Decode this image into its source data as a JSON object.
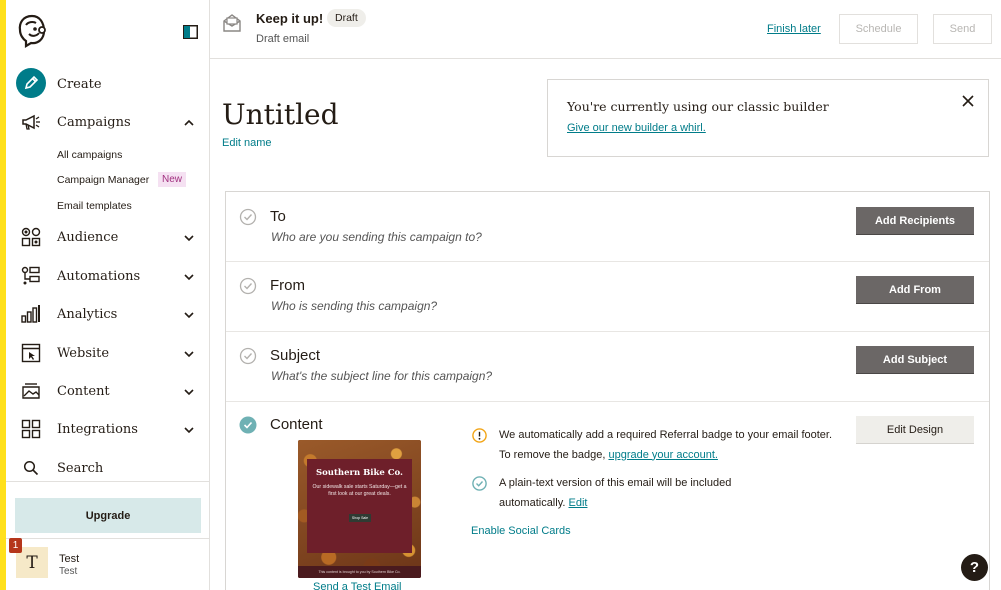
{
  "sidebar": {
    "create_label": "Create",
    "campaigns_label": "Campaigns",
    "campaigns_sub": {
      "all": "All campaigns",
      "manager": "Campaign Manager",
      "new_badge": "New",
      "templates": "Email templates"
    },
    "audience_label": "Audience",
    "automations_label": "Automations",
    "analytics_label": "Analytics",
    "website_label": "Website",
    "content_label": "Content",
    "integrations_label": "Integrations",
    "search_label": "Search",
    "upgrade_label": "Upgrade",
    "account": {
      "initial": "T",
      "name": "Test",
      "sub": "Test",
      "notification_count": "1"
    }
  },
  "topbar": {
    "title": "Keep it up!",
    "badge": "Draft",
    "subtitle": "Draft email",
    "finish_later": "Finish later",
    "schedule": "Schedule",
    "send": "Send"
  },
  "main": {
    "campaign_title": "Untitled",
    "edit_name": "Edit name",
    "classic": {
      "text": "You're currently using our classic builder",
      "link": "Give our new builder a whirl."
    },
    "checklist": [
      {
        "title": "To",
        "desc": "Who are you sending this campaign to?",
        "action": "Add Recipients"
      },
      {
        "title": "From",
        "desc": "Who is sending this campaign?",
        "action": "Add From"
      },
      {
        "title": "Subject",
        "desc": "What's the subject line for this campaign?",
        "action": "Add Subject"
      },
      {
        "title": "Content",
        "action": "Edit Design"
      }
    ],
    "content": {
      "thumbnail": {
        "title": "Southern Bike Co.",
        "text": "Our sidewalk sale starts Saturday—get a first look at our great deals.",
        "button": "Shop Sale",
        "footer": "This content is brought to you by Southern Bike Co."
      },
      "send_test": "Send a Test Email",
      "notice1_text": "We automatically add a required Referral badge to your email footer. To remove the badge,",
      "notice1_link": "upgrade your account.",
      "notice2_text": "A plain-text version of this email will be included automatically.",
      "notice2_link": "Edit",
      "social_cards": "Enable Social Cards"
    }
  },
  "help_label": "?",
  "colors": {
    "accent": "#007c89",
    "yellow": "#ffe01b",
    "dark_button": "#6b6766",
    "check_done": "#6fb1b4",
    "warning": "#f2a517"
  }
}
